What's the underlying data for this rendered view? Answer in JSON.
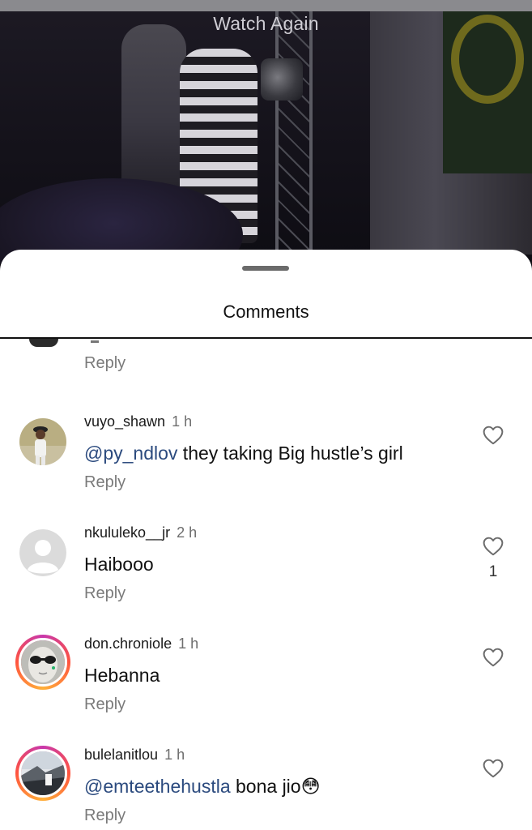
{
  "video": {
    "watch_again_label": "Watch Again"
  },
  "sheet": {
    "title": "Comments"
  },
  "partial_comment": {
    "reply_label": "Reply"
  },
  "comments": [
    {
      "username": "vuyo_shawn",
      "time": "1 h",
      "mention": "@py_ndlov",
      "text": " they taking Big hustle’s girl",
      "reply_label": "Reply",
      "likes": ""
    },
    {
      "username": "nkululeko__jr",
      "time": "2 h",
      "mention": "",
      "text": "Haibooo",
      "reply_label": "Reply",
      "likes": "1"
    },
    {
      "username": "don.chroniole",
      "time": "1 h",
      "mention": "",
      "text": "Hebanna",
      "reply_label": "Reply",
      "likes": ""
    },
    {
      "username": "bulelanitlou",
      "time": "1 h",
      "mention": "@emteethehustla",
      "text": " bona jio😳",
      "reply_label": "Reply",
      "likes": ""
    }
  ],
  "colors": {
    "mention": "#2b4a7e",
    "reply": "#7a7a7a",
    "story_ring": "#c837ab"
  },
  "icons": {
    "like": "heart-outline-icon",
    "avatar_placeholder": "default-avatar-icon"
  }
}
